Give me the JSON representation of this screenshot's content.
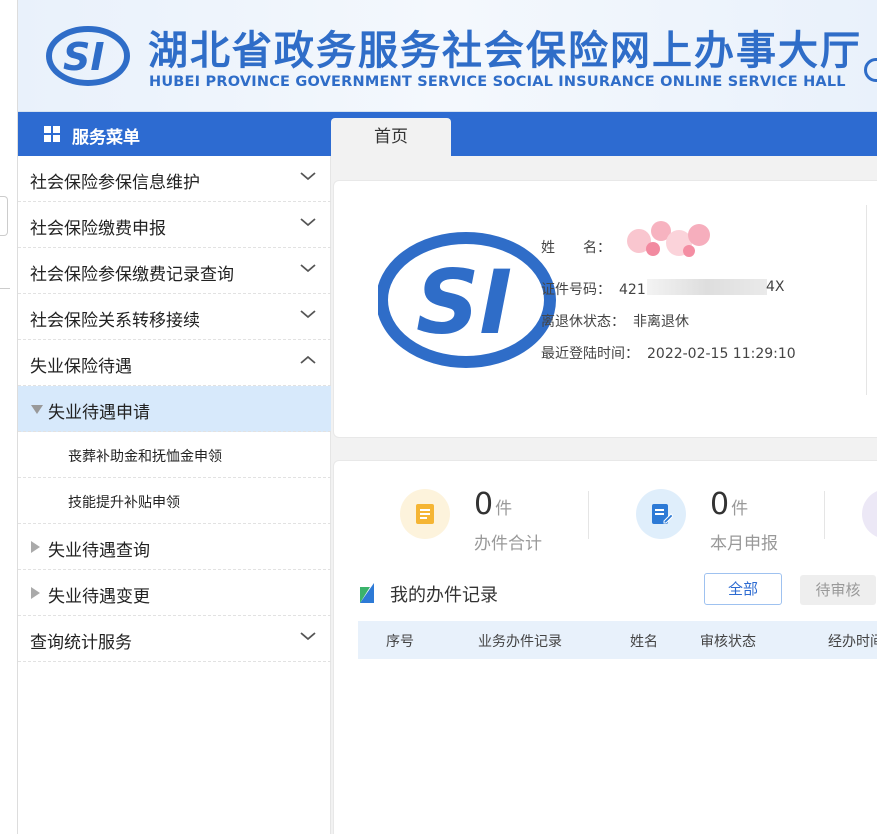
{
  "header": {
    "title_cn": "湖北省政务服务社会保险网上办事大厅",
    "title_en": "HUBEI PROVINCE GOVERNMENT SERVICE SOCIAL INSURANCE ONLINE SERVICE HALL",
    "brand_color": "#2f6dc8"
  },
  "menu": {
    "title": "服务菜单",
    "items": [
      {
        "label": "社会保险参保信息维护"
      },
      {
        "label": "社会保险缴费申报"
      },
      {
        "label": "社会保险参保缴费记录查询"
      },
      {
        "label": "社会保险关系转移接续"
      },
      {
        "label": "失业保险待遇"
      },
      {
        "label": "失业待遇申请"
      },
      {
        "label": "丧葬补助金和抚恤金申领"
      },
      {
        "label": "技能提升补贴申领"
      },
      {
        "label": "失业待遇查询"
      },
      {
        "label": "失业待遇变更"
      },
      {
        "label": "查询统计服务"
      }
    ]
  },
  "tabs": {
    "home": "首页"
  },
  "profile": {
    "name_label": "姓　　名：",
    "id_label": "证件号码：",
    "id_prefix": "421",
    "id_suffix": "4X",
    "retire_label": "离退休状态：",
    "retire_value": "非离退休",
    "login_label": "最近登陆时间：",
    "login_value": "2022-02-15 11:29:10"
  },
  "stats": [
    {
      "num": "0",
      "unit": "件",
      "label": "办件合计",
      "color": "#f5a623"
    },
    {
      "num": "0",
      "unit": "件",
      "label": "本月申报",
      "color": "#2d7ad6"
    }
  ],
  "records": {
    "title": "我的办件记录",
    "btn_all": "全部",
    "btn_pending": "待审核",
    "columns": [
      "序号",
      "业务办件记录",
      "姓名",
      "审核状态",
      "经办时间"
    ]
  }
}
